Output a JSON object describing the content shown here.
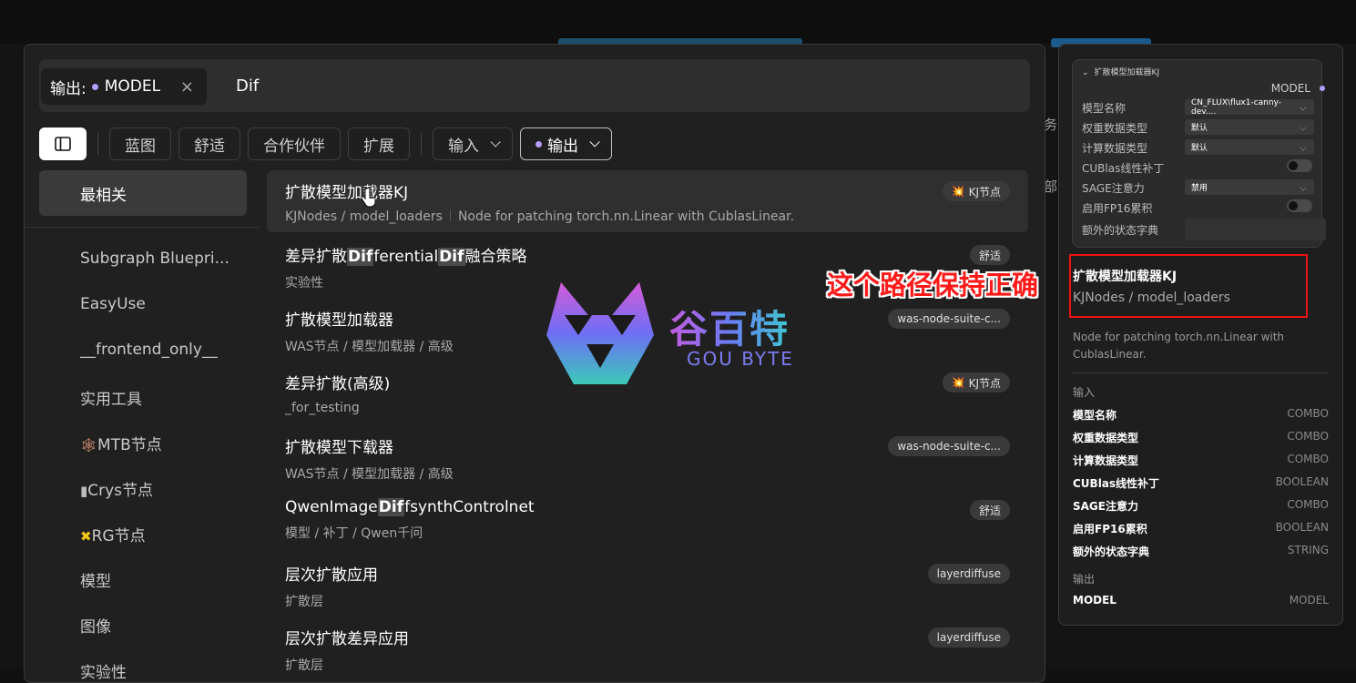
{
  "search": {
    "filter_label": "输出:",
    "filter_value": "MODEL",
    "filter_remove": "×",
    "query": "Dif"
  },
  "toolbar": {
    "tabs": [
      "蓝图",
      "舒适",
      "合作伙伴",
      "扩展"
    ],
    "input_dropdown": "输入",
    "output_dropdown": "输出"
  },
  "sidebar": {
    "selected": "最相关",
    "items": [
      "Subgraph Bluepri...",
      "EasyUse",
      "__frontend_only__",
      "实用工具",
      "MTB节点",
      "Crys节点",
      "RG节点",
      "模型",
      "图像",
      "实验性"
    ],
    "icons": {
      "mtb": "🕸",
      "crys": "▮",
      "rg": "✖"
    }
  },
  "results": [
    {
      "title_parts": [
        "扩散模型加载器KJ"
      ],
      "highlight": [],
      "sub": "KJNodes / model_loaders",
      "desc": "Node for patching torch.nn.Linear with CublasLinear.",
      "badge": "KJ节点",
      "badge_icon": "💥"
    },
    {
      "title_parts": [
        "差异扩散",
        "Dif",
        "ferential",
        "Dif",
        "融合策略"
      ],
      "sub": "实验性",
      "badge": "舒适"
    },
    {
      "title_parts": [
        "扩散模型加载器"
      ],
      "sub": "WAS节点 / 模型加载器 / 高级",
      "badge": "was-node-suite-c..."
    },
    {
      "title_parts": [
        "差异扩散(高级)"
      ],
      "sub": "_for_testing",
      "badge": "KJ节点",
      "badge_icon": "💥"
    },
    {
      "title_parts": [
        "扩散模型下载器"
      ],
      "sub": "WAS节点 / 模型加载器 / 高级",
      "badge": "was-node-suite-c..."
    },
    {
      "title_parts": [
        "QwenImage",
        "Dif",
        "fsynthControlnet"
      ],
      "sub": "模型 / 补丁 / Qwen千问",
      "badge": "舒适"
    },
    {
      "title_parts": [
        "层次扩散应用"
      ],
      "sub": "扩散层",
      "badge": "layerdiffuse"
    },
    {
      "title_parts": [
        "层次扩散差异应用"
      ],
      "sub": "扩散层",
      "badge": "layerdiffuse"
    }
  ],
  "watermark": {
    "cn": "谷百特",
    "en": "GOU BYTE"
  },
  "annotation": "这个路径保持正确",
  "preview": {
    "card_title": "扩散模型加载器KJ",
    "card_output": "MODEL",
    "rows": [
      {
        "label": "模型名称",
        "value": "CN_FLUX\\flux1-canny-dev...."
      },
      {
        "label": "权重数据类型",
        "value": "默认"
      },
      {
        "label": "计算数据类型",
        "value": "默认"
      },
      {
        "label": "CUBlas线性补丁"
      },
      {
        "label": "SAGE注意力",
        "value": "禁用"
      },
      {
        "label": "启用FP16累积"
      },
      {
        "label": "额外的状态字典"
      }
    ],
    "title": "扩散模型加载器KJ",
    "path": "KJNodes / model_loaders",
    "description": "Node for patching torch.nn.Linear with CublasLinear.",
    "inputs_label": "输入",
    "inputs": [
      {
        "name": "模型名称",
        "type": "COMBO"
      },
      {
        "name": "权重数据类型",
        "type": "COMBO"
      },
      {
        "name": "计算数据类型",
        "type": "COMBO"
      },
      {
        "name": "CUBlas线性补丁",
        "type": "BOOLEAN"
      },
      {
        "name": "SAGE注意力",
        "type": "COMBO"
      },
      {
        "name": "启用FP16累积",
        "type": "BOOLEAN"
      },
      {
        "name": "额外的状态字典",
        "type": "STRING"
      }
    ],
    "outputs_label": "输出",
    "outputs": [
      {
        "name": "MODEL",
        "type": "MODEL"
      }
    ]
  },
  "background_edge": {
    "a": "务",
    "b": "部"
  }
}
